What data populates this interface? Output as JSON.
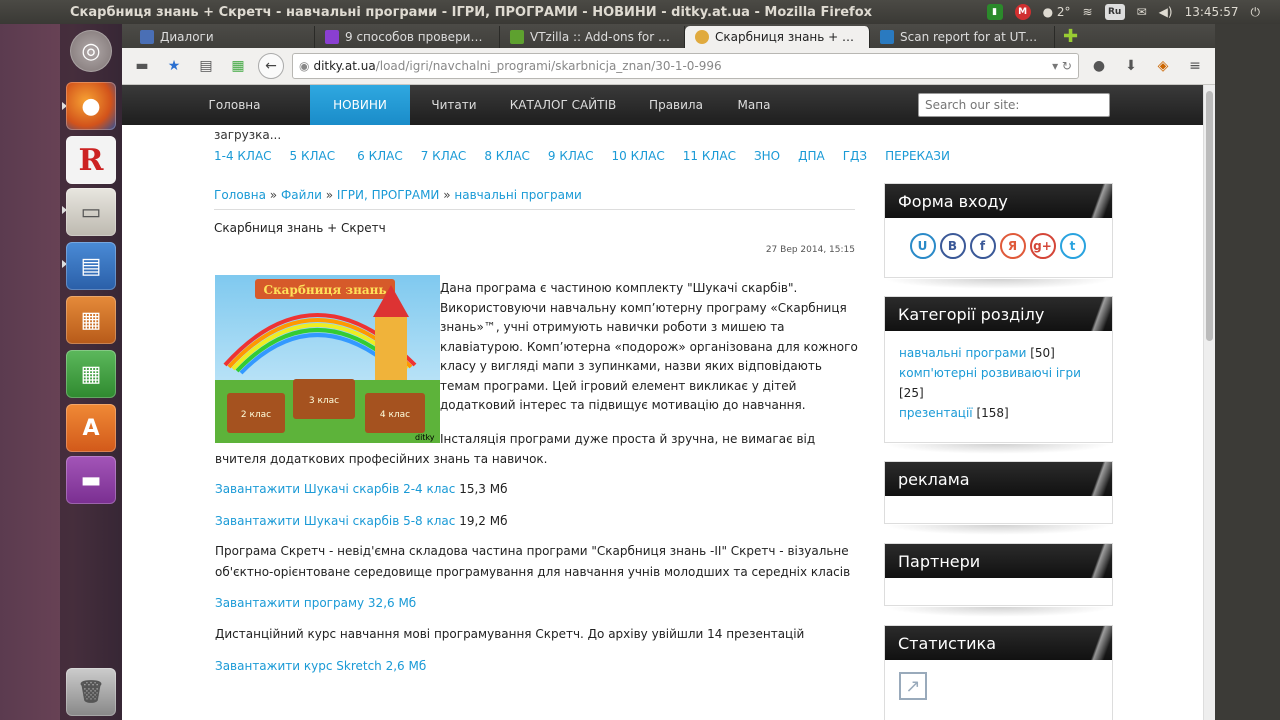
{
  "window": {
    "title": "Скарбниця знань + Скретч - навчальні програми - ІГРИ, ПРОГРАМИ - НОВИНИ - ditky.at.ua - Mozilla Firefox"
  },
  "tray": {
    "temp": "2°",
    "lang": "Ru",
    "time": "13:45:57",
    "mail_badge": "M"
  },
  "tabs": [
    {
      "label": "Диалоги",
      "color": "#4a6fb5"
    },
    {
      "label": "9 способов проверит…",
      "color": "#8a3fd1"
    },
    {
      "label": "VTzilla :: Add-ons for Fi…",
      "color": "#5ea12f"
    },
    {
      "label": "Скарбниця знань + Ск…",
      "color": "#e0aa3e"
    },
    {
      "label": "Scan report for at UTC …",
      "color": "#2a7ac0"
    }
  ],
  "url": {
    "host": "ditky.at.ua",
    "path": "/load/igri/navchalni_programi/skarbnicja_znan/30-1-0-996"
  },
  "sitenav": {
    "items": [
      "Головна",
      "НОВИНИ",
      "Читати",
      "КАТАЛОГ САЙТІВ",
      "Правила",
      "Мапа"
    ],
    "active": "НОВИНИ",
    "search_placeholder": "Search our site:"
  },
  "loading_text": "загрузка...",
  "class_links": [
    "1-4 КЛАС",
    "5 КЛАС",
    "6 КЛАС",
    "7 КЛАС",
    "8 КЛАС",
    "9 КЛАС",
    "10 КЛАС",
    "11 КЛАС",
    "ЗНО",
    "ДПА",
    "ГДЗ",
    "ПЕРЕКАЗИ"
  ],
  "breadcrumb": {
    "items": [
      "Головна",
      "Файли",
      "ІГРИ, ПРОГРАМИ",
      "навчальні програми"
    ],
    "sep": "»"
  },
  "article": {
    "title": "Скарбниця знань + Скретч",
    "date": "27 Вер 2014, 15:15",
    "image_title": "Скарбниця знань",
    "image_labels": [
      "2 клас",
      "3 клас",
      "4 клас"
    ],
    "image_watermark": "ditky",
    "text1": "Дана програма є частиною комплекту \"Шукачі скарбів\". Використовуючи навчальну комп’ютерну програму «Скарбниця знань»™, учні отримують навички роботи з мишею та клавіатурою. Комп’ютерна «подорож» організована для кожного класу у вигляді мапи з зупинками, назви яких відповідають темам програми. Цей ігровий елемент викликає у дітей додатковий інтерес та підвищує мотивацію до навчання.",
    "text2": "Інсталяція програми дуже проста й зручна, не вимагає від вчителя додаткових професійних знань та навичок.",
    "dl1_link": "Завантажити  Шукачі скарбів 2-4 клас",
    "dl1_size": "15,3 Мб",
    "dl2_link": "Завантажити Шукачі скарбів  5-8 клас",
    "dl2_size": "19,2 Мб",
    "para1": "Програма Скретч - невід'ємна складова частина програми \"Скарбниця знань -II\" Скретч - візуальне об'єктно-орієнтоване середовище програмування для навчання учнів молодших та середніх класів",
    "dl3_link": "Завантажити програму 32,6 Мб",
    "para2": "Дистанційний курс навчання мові програмування Скретч. До архіву увійшли 14 презентацій",
    "dl4_link": "Завантажити курс Skretch 2,6 Мб"
  },
  "sidebar": {
    "login_title": "Форма входу",
    "social": [
      {
        "glyph": "U",
        "color": "#2a8ac8"
      },
      {
        "glyph": "B",
        "color": "#3b5998"
      },
      {
        "glyph": "f",
        "color": "#3b5998"
      },
      {
        "glyph": "Я",
        "color": "#e05a3a"
      },
      {
        "glyph": "g+",
        "color": "#d44638"
      },
      {
        "glyph": "t",
        "color": "#29a3df"
      }
    ],
    "categories_title": "Категорії розділу",
    "categories": [
      {
        "label": "навчальні програми",
        "count": "[50]"
      },
      {
        "label": "комп'ютерні розвиваючі ігри",
        "count": "[25]"
      },
      {
        "label": "презентації",
        "count": "[158]"
      }
    ],
    "ads_title": "реклама",
    "partners_title": "Партнери",
    "stats_title": "Статистика"
  }
}
